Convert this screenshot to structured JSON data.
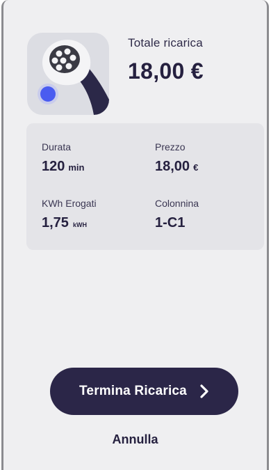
{
  "summary": {
    "icon": "ev-charger-plug-icon",
    "total_label": "Totale ricarica",
    "total_value": "18,00 €"
  },
  "details": {
    "durata": {
      "label": "Durata",
      "value": "120",
      "unit": "min"
    },
    "prezzo": {
      "label": "Prezzo",
      "value": "18,00",
      "unit": "€"
    },
    "kwh": {
      "label": "KWh Erogati",
      "value": "1,75",
      "unit": "kWH"
    },
    "colonnina": {
      "label": "Colonnina",
      "value": "1-C1"
    }
  },
  "actions": {
    "primary_label": "Termina Ricarica",
    "primary_icon": "chevron-right-icon",
    "cancel_label": "Annulla"
  },
  "colors": {
    "primary": "#2b2648",
    "background": "#efeff1",
    "card": "#e4e4e8",
    "indicator": "#4a5cf0"
  }
}
